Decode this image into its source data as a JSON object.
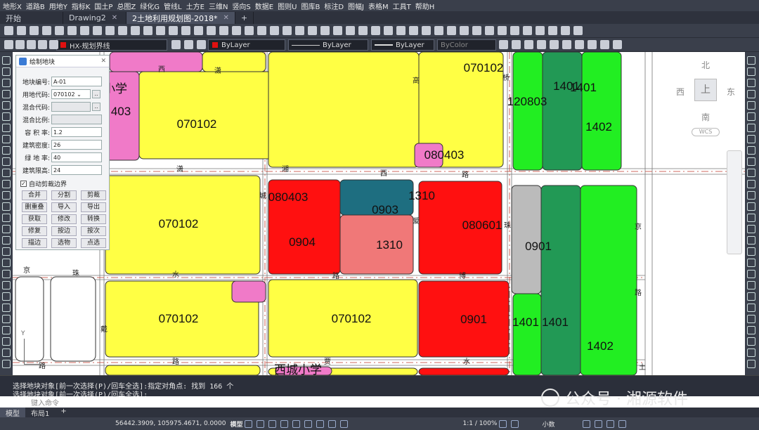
{
  "menu": [
    "地形X",
    "道路B",
    "用地Y",
    "指标K",
    "国土P",
    "总图Z",
    "绿化G",
    "管线L",
    "土方E",
    "三维N",
    "竖向S",
    "数据E",
    "图则U",
    "图库B",
    "标注D",
    "图幅J",
    "表格M",
    "工具T",
    "帮助H"
  ],
  "tabs": [
    {
      "label": "开始",
      "active": false
    },
    {
      "label": "Drawing2",
      "active": false
    },
    {
      "label": "2土地利用规划图-2018*",
      "active": true
    }
  ],
  "toolbar": {
    "layer_name": "HX-规划界线",
    "color_value": "ByLayer",
    "linetype_value": "ByLayer",
    "lineweight_value": "ByLayer",
    "plotstyle_value": "ByColor"
  },
  "dialog": {
    "title": "绘制地块",
    "fields": [
      {
        "label": "地块编号:",
        "value": "A-01",
        "kind": "text"
      },
      {
        "label": "用地代码:",
        "value": "070102",
        "kind": "combo"
      },
      {
        "label": "混合代码:",
        "value": "",
        "kind": "disabled"
      },
      {
        "label": "混合比例:",
        "value": "",
        "kind": "disabled"
      },
      {
        "label": "容 积 率:",
        "value": "1.2",
        "kind": "text"
      },
      {
        "label": "建筑密度:",
        "value": "26",
        "kind": "text"
      },
      {
        "label": "绿 地 率:",
        "value": "40",
        "kind": "text"
      },
      {
        "label": "建筑限高:",
        "value": "24",
        "kind": "text"
      }
    ],
    "auto_clip_label": "自动剪裁边界",
    "buttons": [
      [
        "合并",
        "分割",
        "剪裁"
      ],
      [
        "删重叠",
        "导入",
        "导出"
      ],
      [
        "获取",
        "修改",
        "转换"
      ],
      [
        "修复",
        "按边",
        "按次"
      ],
      [
        "描边",
        "选物",
        "点选"
      ]
    ]
  },
  "map": {
    "parcels": [
      {
        "code": "070102"
      },
      {
        "code": "070102"
      },
      {
        "code": "070102"
      },
      {
        "code": "070102"
      },
      {
        "code": "070102"
      },
      {
        "code": "080403"
      },
      {
        "code": "080403"
      },
      {
        "code": "0904"
      },
      {
        "code": "0903"
      },
      {
        "code": "1310"
      },
      {
        "code": "1310"
      },
      {
        "code": "080601"
      },
      {
        "code": "0901"
      },
      {
        "code": "0901"
      },
      {
        "code": "120803"
      },
      {
        "code": "1401"
      },
      {
        "code": "1402"
      },
      {
        "code": "1401"
      },
      {
        "code": "1401"
      },
      {
        "code": "1402"
      },
      {
        "code": "1401"
      },
      {
        "code": "403"
      },
      {
        "code": "小学"
      },
      {
        "code": "西城小学"
      }
    ],
    "road_labels": [
      "潇",
      "湘",
      "西",
      "路",
      "城",
      "爱",
      "珠",
      "京",
      "水",
      "路",
      "博",
      "京",
      "珠",
      "高",
      "桥",
      "路",
      "土",
      "贾",
      "水",
      "路",
      "戴",
      "路",
      "西",
      "潇"
    ],
    "compass": {
      "n": "北",
      "s": "南",
      "e": "东",
      "w": "西",
      "center": "上",
      "wcs": "WCS"
    }
  },
  "command": {
    "line1": "选择地块对象[前一次选择(P)/回车全选]:指定对角点: 找到 166 个",
    "line2": "选择地块对象[前一次选择(P)/回车全选]:",
    "placeholder": "键入命令"
  },
  "layout_tabs": [
    "模型",
    "布局1",
    "+"
  ],
  "status": {
    "coords": "56442.3909, 105975.4671, 0.0000",
    "model": "模型",
    "scale": "1:1 / 100%",
    "units": "小数"
  },
  "watermark": "公众号 · 湘源软件",
  "colors": {
    "yellow": "#ffff44",
    "red": "#ff1010",
    "pink": "#f07ac8",
    "teal": "#1e6e80",
    "salmon": "#f07878",
    "green": "#22ee22",
    "darkgreen": "#229955",
    "gray": "#bbbbbb"
  }
}
